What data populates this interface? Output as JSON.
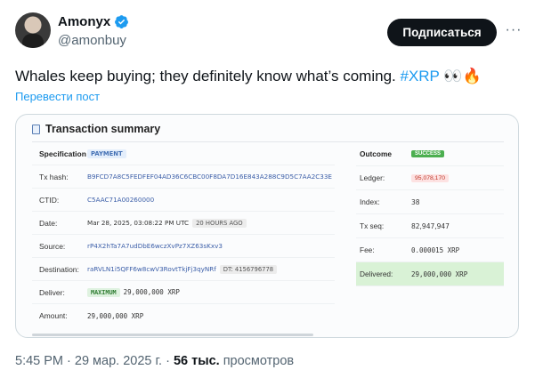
{
  "author": {
    "name": "Amonyx",
    "handle": "@amonbuy"
  },
  "follow_label": "Подписаться",
  "more_label": "···",
  "tweet": {
    "text_before": "Whales keep buying; they definitely know what’s coming. ",
    "hashtag": "#XRP",
    "emojis": " 👀🔥",
    "translate_label": "Перевести пост"
  },
  "card": {
    "title": "Transaction summary",
    "left": {
      "spec_label": "Specification",
      "spec_value": "PAYMENT",
      "txhash_label": "Tx hash:",
      "txhash_value": "B9FCD7A8C5FEDFEF04AD36C6CBC00F8DA7D16E843A288C9D5C7AA2C33E",
      "ctid_label": "CTID:",
      "ctid_value": "C5AAC71A00260000",
      "date_label": "Date:",
      "date_value": "Mar 28, 2025, 03:08:22 PM UTC",
      "date_ago": "20 HOURS AGO",
      "source_label": "Source:",
      "source_value": "rP4X2hTa7A7udDbE6wczXvPz7XZ63sKxv3",
      "dest_label": "Destination:",
      "dest_value": "raRVLN1i5QFF6w8cwV3RovtTkjFj3qyNRf",
      "dest_tag": "DT: 4156796778",
      "deliver_label": "Deliver:",
      "deliver_chip": "MAXIMUM",
      "deliver_value": "29,000,000 XRP",
      "amount_label": "Amount:",
      "amount_value": "29,000,000 XRP"
    },
    "right": {
      "outcome_label": "Outcome",
      "outcome_value": "SUCCESS",
      "ledger_label": "Ledger:",
      "ledger_value": "95,078,170",
      "index_label": "Index:",
      "index_value": "38",
      "txseq_label": "Tx seq:",
      "txseq_value": "82,947,947",
      "fee_label": "Fee:",
      "fee_value": "0.000015 XRP",
      "delivered_label": "Delivered:",
      "delivered_value": "29,000,000 XRP"
    }
  },
  "meta": {
    "time": "5:45 PM",
    "sep": " · ",
    "date": "29 мар. 2025 г.",
    "views_count": "56 тыс.",
    "views_label": " просмотров"
  },
  "colors": {
    "accent": "#1d9bf0",
    "button": "#0f1419",
    "delivered_bg": "#d9f2d6"
  }
}
